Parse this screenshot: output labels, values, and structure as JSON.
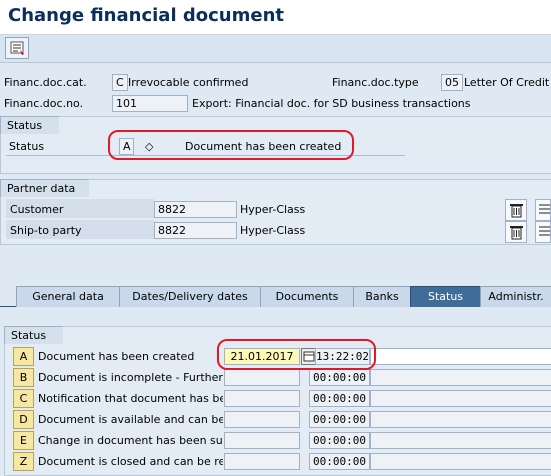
{
  "window": {
    "title": "Change financial document"
  },
  "header": {
    "doc_cat_label": "Financ.doc.cat.",
    "doc_cat_value": "C",
    "doc_cat_text": "Irrevocable confirmed",
    "doc_type_label": "Financ.doc.type",
    "doc_type_value": "05",
    "doc_type_text": "Letter Of Credit",
    "doc_no_label": "Financ.doc.no.",
    "doc_no_value": "101",
    "doc_no_text": "Export: Financial doc. for SD business transactions"
  },
  "status_section": {
    "title": "Status",
    "label": "Status",
    "code": "A",
    "symbol": "◇",
    "text": "Document has been created"
  },
  "partner_section": {
    "title": "Partner data",
    "rows": [
      {
        "label": "Customer",
        "number": "8822",
        "name": "Hyper-Class"
      },
      {
        "label": "Ship-to party",
        "number": "8822",
        "name": "Hyper-Class"
      }
    ]
  },
  "tabs": [
    {
      "label": "General data"
    },
    {
      "label": "Dates/Delivery dates"
    },
    {
      "label": "Documents"
    },
    {
      "label": "Banks"
    },
    {
      "label": "Status"
    },
    {
      "label": "Administr."
    }
  ],
  "status_table": {
    "title": "Status",
    "rows": [
      {
        "code": "A",
        "desc": "Document has been created",
        "date": "21.01.2017",
        "time": "13:22:02"
      },
      {
        "code": "B",
        "desc": "Document is incomplete - Further",
        "date": "",
        "time": "00:00:00"
      },
      {
        "code": "C",
        "desc": "Notification that document has bee",
        "date": "",
        "time": "00:00:00"
      },
      {
        "code": "D",
        "desc": "Document is available and can be",
        "date": "",
        "time": "00:00:00"
      },
      {
        "code": "E",
        "desc": "Change in document has been su",
        "date": "",
        "time": "00:00:00"
      },
      {
        "code": "Z",
        "desc": "Document is closed and can be re",
        "date": "",
        "time": "00:00:00"
      }
    ]
  },
  "colors": {
    "highlight": "#e1192b",
    "active_tab": "#3f6d98",
    "title": "#0c2e5c"
  },
  "icons": {
    "toolbar": "display-change-icon",
    "partner": "trash-icon",
    "details": "details-icon",
    "calendar": "calendar-icon"
  }
}
